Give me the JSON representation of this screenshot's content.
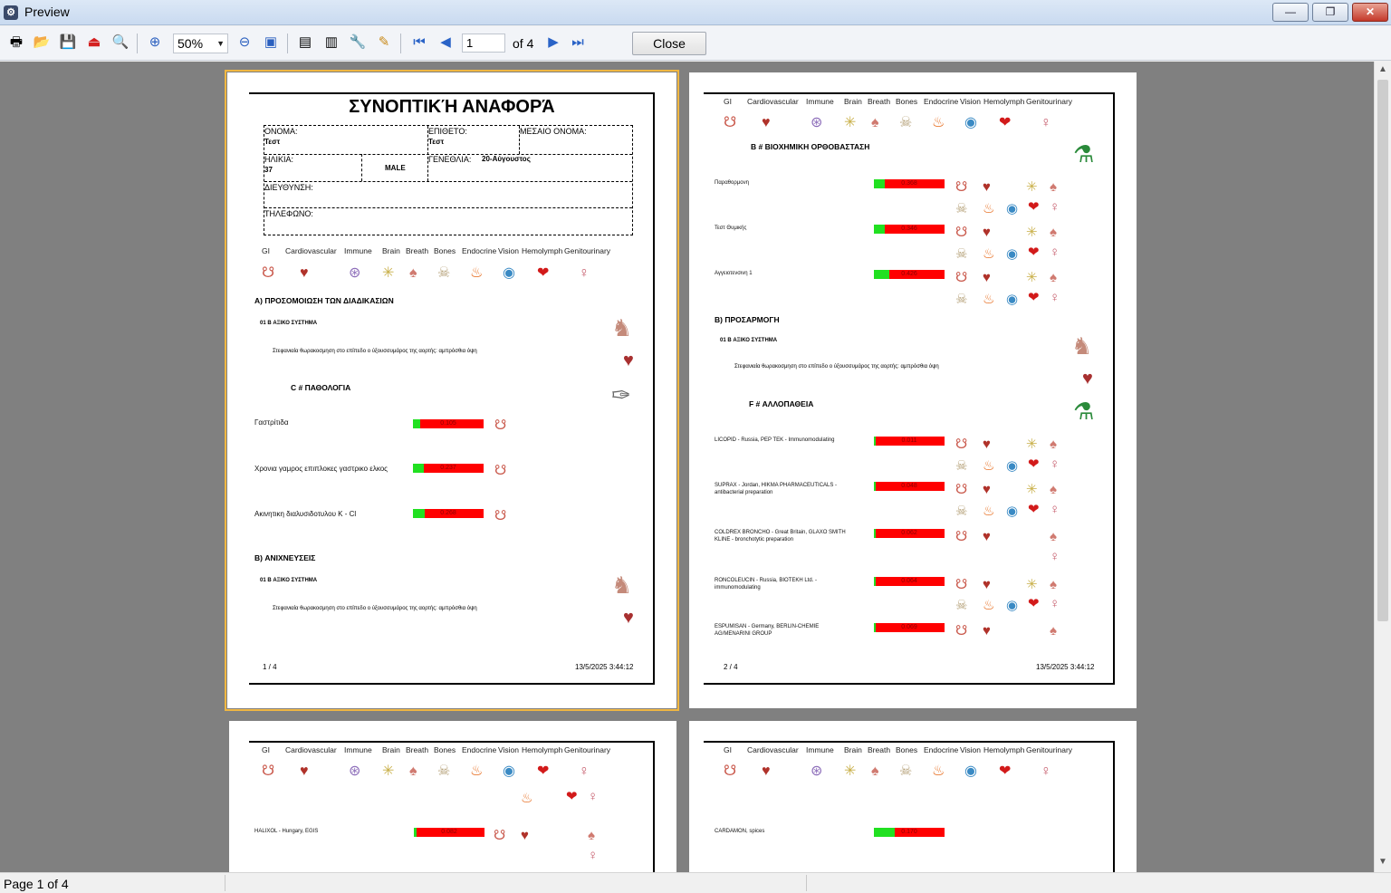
{
  "window": {
    "title": "Preview",
    "minimize": "—",
    "restore": "❐",
    "close": "✕"
  },
  "toolbar": {
    "zoom": "50%",
    "page_input": "1",
    "of_label": "of 4",
    "close_label": "Close"
  },
  "status": {
    "text": "Page 1 of 4"
  },
  "categories": [
    "GI",
    "Cardiovascular",
    "Immune",
    "Brain",
    "Breath",
    "Bones",
    "Endocrine",
    "Vision",
    "Hemolymph",
    "Genitourinary"
  ],
  "page1": {
    "title": "ΣΥΝΟΠΤΙΚΉ ΑΝΑΦΟΡΆ",
    "name_label": "ΟΝΟΜΑ:",
    "name_value": "Τεστ",
    "surname_label": "ΕΠΙΘΕΤΟ:",
    "surname_value": "Τεστ",
    "middle_label": "ΜΕΣΑΙΟ ΟΝΟΜΑ:",
    "age_label": "ΗΛΙΚΙΑ:",
    "age_value": "37",
    "sex_value": "MALE",
    "birthday_label": "ΓΕΝΕΘΛΙΑ:",
    "birthday_value": "20-Αύγουστος",
    "address_label": "ΔΙΕΥΘΥΝΣΗ:",
    "phone_label": "ΤΗΛΕΦΩΝΟ:",
    "sectionA": "A) ΠΡΟΣΟΜΟΙΩΣΗ ΤΩΝ ΔΙΑΔΙΚΑΣΙΩΝ",
    "sub1": "01 B ΑΞΙΚΟ ΣΥΣΤΗΜΑ",
    "desc1": "Στεφανιαία θωρακοσμηση στο επίπεδο ο ύξουσσυμάρος της αορτής: αμπρόσθια όψη",
    "pathology": "C # ΠΑΘΟΛΟΓΙΑ",
    "rows": [
      {
        "label": "Γαστρίτιδα",
        "value": "0.105",
        "green": 0.1
      },
      {
        "label": "Χρονια γαμρος επιπλοκες γαστρικο ελκος",
        "value": "0.237",
        "green": 0.15
      },
      {
        "label": "Ακινητικη διαλυσιδοτυλου K - Cl",
        "value": "0.268",
        "green": 0.17
      }
    ],
    "sectionB": "B) ΑΝΙΧΝΕΥΣΕΙΣ",
    "sub2": "01 B ΑΞΙΚΟ ΣΥΣΤΗΜΑ",
    "desc2": "Στεφανιαία θωρακοσμηση στο επίπεδο ο ύξουσσυμάρος της αορτής: αμπρόσθια όψη",
    "footer_page": "1 / 4",
    "footer_date": "13/5/2025 3:44:12"
  },
  "page2": {
    "sectionB": "B # ΒΙΟΧΗΜΙΚΗ ΟΡΘΟΒΑΣΤΑΣΗ",
    "rows1": [
      {
        "label": "Παραθορμονη",
        "value": "0.368",
        "green": 0.15
      },
      {
        "label": "Τεστ Θυμικής",
        "value": "0.346",
        "green": 0.15
      },
      {
        "label": "Αγγειοτενσινη 1",
        "value": "0.426",
        "green": 0.22
      }
    ],
    "adaptation": "B) ΠΡΟΣΑΡΜΟΓΗ",
    "sub1": "01 B ΑΞΙΚΟ ΣΥΣΤΗΜΑ",
    "desc1": "Στεφανιαία θωρακοσμηση στο επίπεδο ο ύξουσσυμάρος της αορτής: αμπρόσθια όψη",
    "allopathy": "F # ΑΛΛΟΠΑΘΕΙΑ",
    "rows2": [
      {
        "label": "LICOPID - Russia, PEP TEK - Immunomodulating",
        "label2": "",
        "value": "0.011",
        "green": 0.02
      },
      {
        "label": "SUPRAX - Jordan, HIKMA PHARMACEUTICALS -",
        "label2": "antibacterial preparation",
        "value": "0.048",
        "green": 0.03
      },
      {
        "label": "COLDREX BRONCHO - Great Britain, GLAXO SMITH",
        "label2": "KLINE - bronchotytic preparation",
        "value": "0.062",
        "green": 0.03
      },
      {
        "label": "RONCOLEUCIN - Russia, BIOTEKH Ltd. -",
        "label2": "immunomodulating",
        "value": "0.064",
        "green": 0.03
      },
      {
        "label": "ESPUMISAN - Germany, BERLIN-CHEMIE",
        "label2": "AG/MENARINI GROUP",
        "value": "0.069",
        "green": 0.03
      }
    ],
    "footer_page": "2 / 4",
    "footer_date": "13/5/2025 3:44:12"
  },
  "page3": {
    "row": {
      "label": "HALIXOL - Hungary, EGIS",
      "value": "0.082",
      "green": 0.04
    }
  },
  "page4": {
    "row": {
      "label": "CARDAMON, spices",
      "value": "0.170",
      "green": 0.3
    }
  }
}
